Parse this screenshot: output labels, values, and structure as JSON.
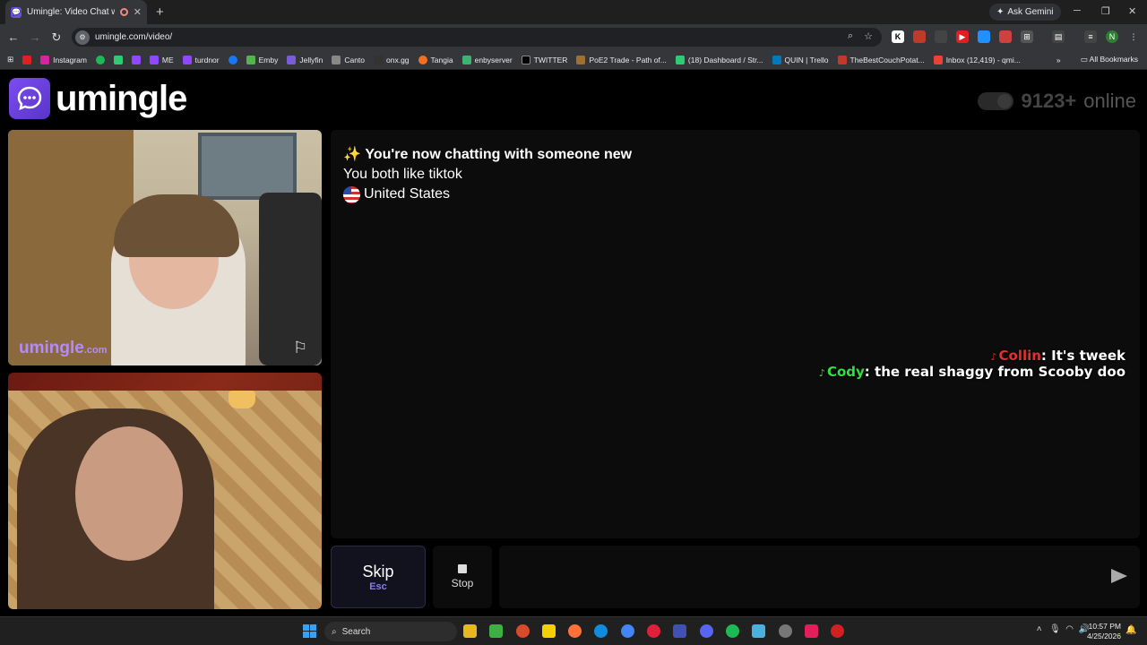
{
  "browser": {
    "tab_title": "Umingle: Video Chat with S",
    "new_tab": "+",
    "ask_gemini": "Ask Gemini",
    "url": "umingle.com/video/",
    "all_bookmarks": "All Bookmarks",
    "bookmarks": [
      "Instagram",
      "ME",
      "turdnor",
      "Emby",
      "Jellyfin",
      "Canto",
      "onx.gg",
      "Tangia",
      "enbyserver",
      "TWITTER",
      "PoE2 Trade - Path of...",
      "(18) Dashboard / Str...",
      "QUIN | Trello",
      "TheBestCouchPotat...",
      "Inbox (12,419) - qmi..."
    ]
  },
  "header": {
    "logo_text": "umingle",
    "online_count": "9123+",
    "online_label": "online"
  },
  "local_video": {
    "watermark": "umingle",
    "watermark_suffix": ".com"
  },
  "chat": {
    "system_line": "You're now chatting with someone new",
    "interest_line": "You both like tiktok",
    "country": "United States",
    "messages": [
      {
        "name": "Collin",
        "text": ": It's tweek"
      },
      {
        "name": "Cody",
        "text": ": the real shaggy from Scooby doo"
      }
    ]
  },
  "controls": {
    "skip_label": "Skip",
    "skip_key": "Esc",
    "stop_label": "Stop"
  },
  "taskbar": {
    "search_label": "Search",
    "time": "10:57 PM",
    "date": "4/25/2026"
  },
  "colors": {
    "accent": "#6a4ee8",
    "collin": "#e03030",
    "cody": "#30e040"
  }
}
